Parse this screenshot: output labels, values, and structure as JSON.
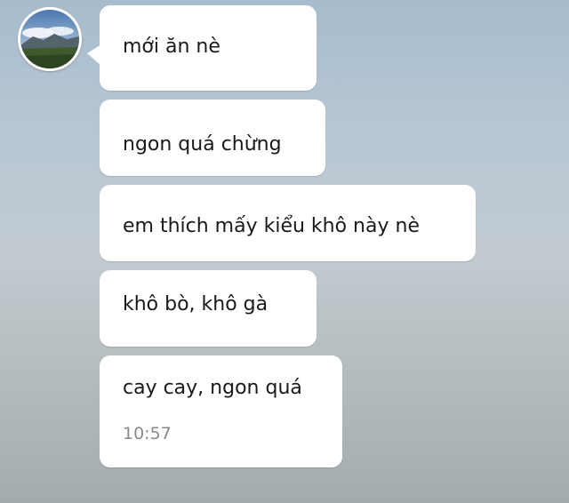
{
  "messages": [
    {
      "text": "mới ăn nè"
    },
    {
      "text": "ngon quá chừng"
    },
    {
      "text": "em thích mấy kiểu khô này nè"
    },
    {
      "text": "khô bò, khô gà"
    },
    {
      "text": "cay cay, ngon quá",
      "time": "10:57"
    }
  ],
  "colors": {
    "bubble": "#ffffff",
    "text": "#1a1a1a",
    "timestamp": "#8a8a8a"
  }
}
